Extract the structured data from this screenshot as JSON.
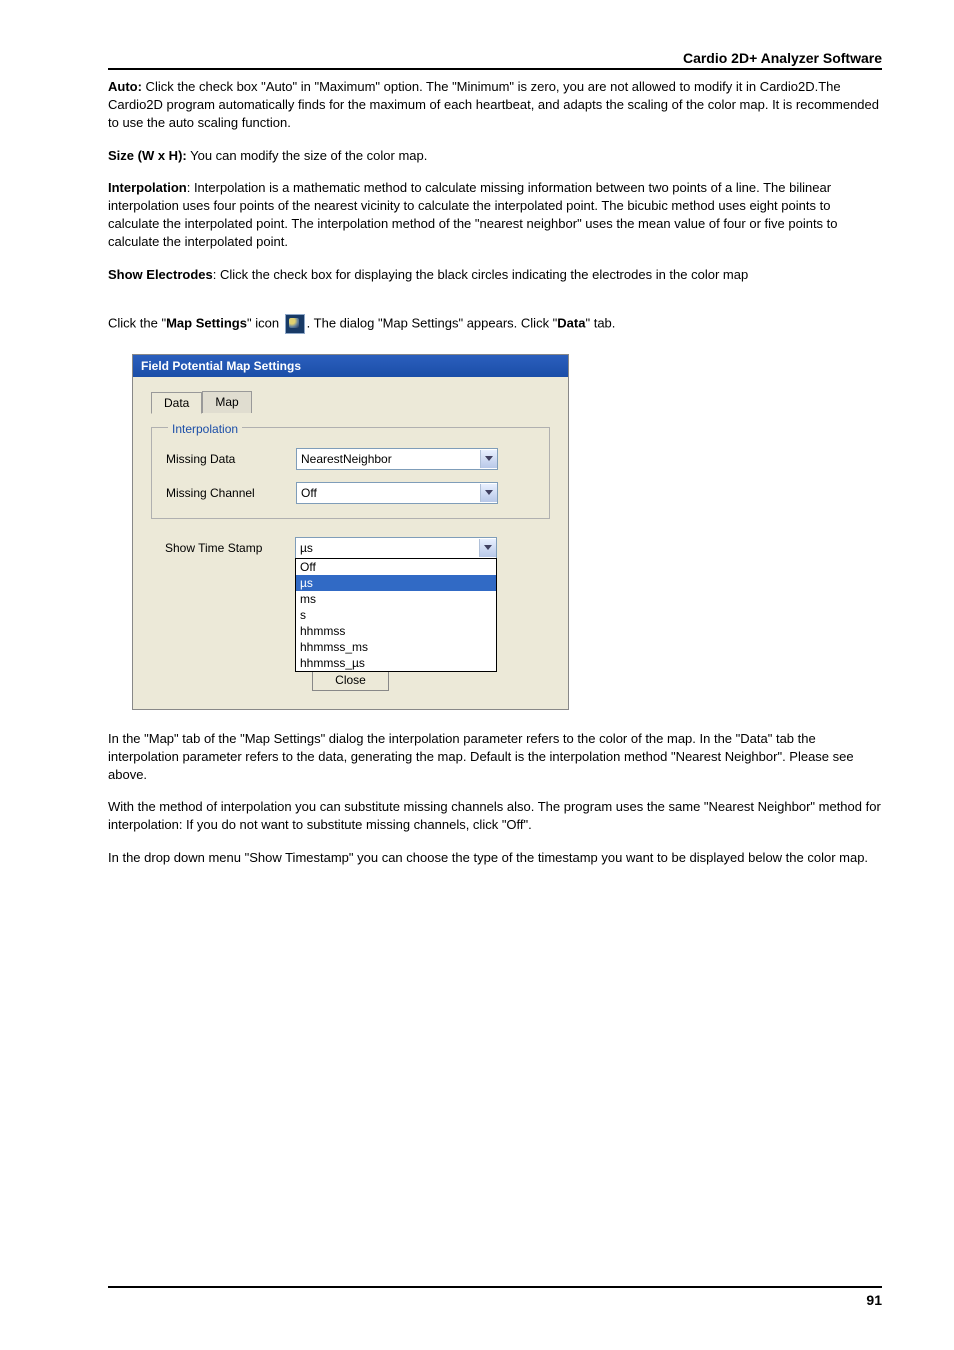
{
  "header": {
    "title": "Cardio 2D+ Analyzer Software"
  },
  "paragraphs": {
    "auto_label": "Auto:",
    "auto_text": " Click the check box \"Auto\" in \"Maximum\" option. The \"Minimum\" is zero, you are not allowed to modify it in Cardio2D.The Cardio2D program automatically finds for the maximum of each heartbeat, and adapts the scaling of the color map. It is recommended to use the auto scaling function.",
    "size_label": "Size (W x H):",
    "size_text": " You can modify the size of the color map.",
    "interp_label": "Interpolation",
    "interp_text": ": Interpolation is a mathematic method to calculate missing information between two points of a line. The bilinear interpolation uses four points of the nearest vicinity to calculate the interpolated point. The bicubic method uses eight points to calculate the interpolated point. The interpolation method of the \"nearest neighbor\" uses the mean value of four or five points to calculate the interpolated point.",
    "electrodes_label": "Show Electrodes",
    "electrodes_text": ": Click the check box for displaying the black circles indicating the electrodes in the color map",
    "click_pre": "Click the \"",
    "click_bold1": "Map Settings",
    "click_mid": "\" icon ",
    "click_post1": ". The dialog \"Map Settings\" appears. Click \"",
    "click_bold2": "Data",
    "click_post2": "\" tab.",
    "after1": "In the \"Map\" tab of the \"Map Settings\" dialog the interpolation parameter refers to the color of the map. In the \"Data\" tab the interpolation parameter refers to the data, generating the map. Default is the interpolation method \"Nearest Neighbor\". Please see above.",
    "after2": "With the method of interpolation you can substitute missing channels also. The program uses the same \"Nearest Neighbor\" method for interpolation: If you do not want to substitute missing channels, click \"Off\".",
    "after3": "In the drop down menu \"Show Timestamp\" you can choose the type of the timestamp you want to be displayed below the color map."
  },
  "dialog": {
    "title": "Field Potential  Map Settings",
    "tabs": {
      "data": "Data",
      "map": "Map"
    },
    "interpolation_legend": "Interpolation",
    "missing_data_label": "Missing Data",
    "missing_data_value": "NearestNeighbor",
    "missing_channel_label": "Missing Channel",
    "missing_channel_value": "Off",
    "timestamp_label": "Show Time Stamp",
    "timestamp_value": "µs",
    "timestamp_options": [
      "Off",
      "µs",
      "ms",
      "s",
      "hhmmss",
      "hhmmss_ms",
      "hhmmss_µs"
    ],
    "close": "Close"
  },
  "footer": {
    "page": "91"
  }
}
